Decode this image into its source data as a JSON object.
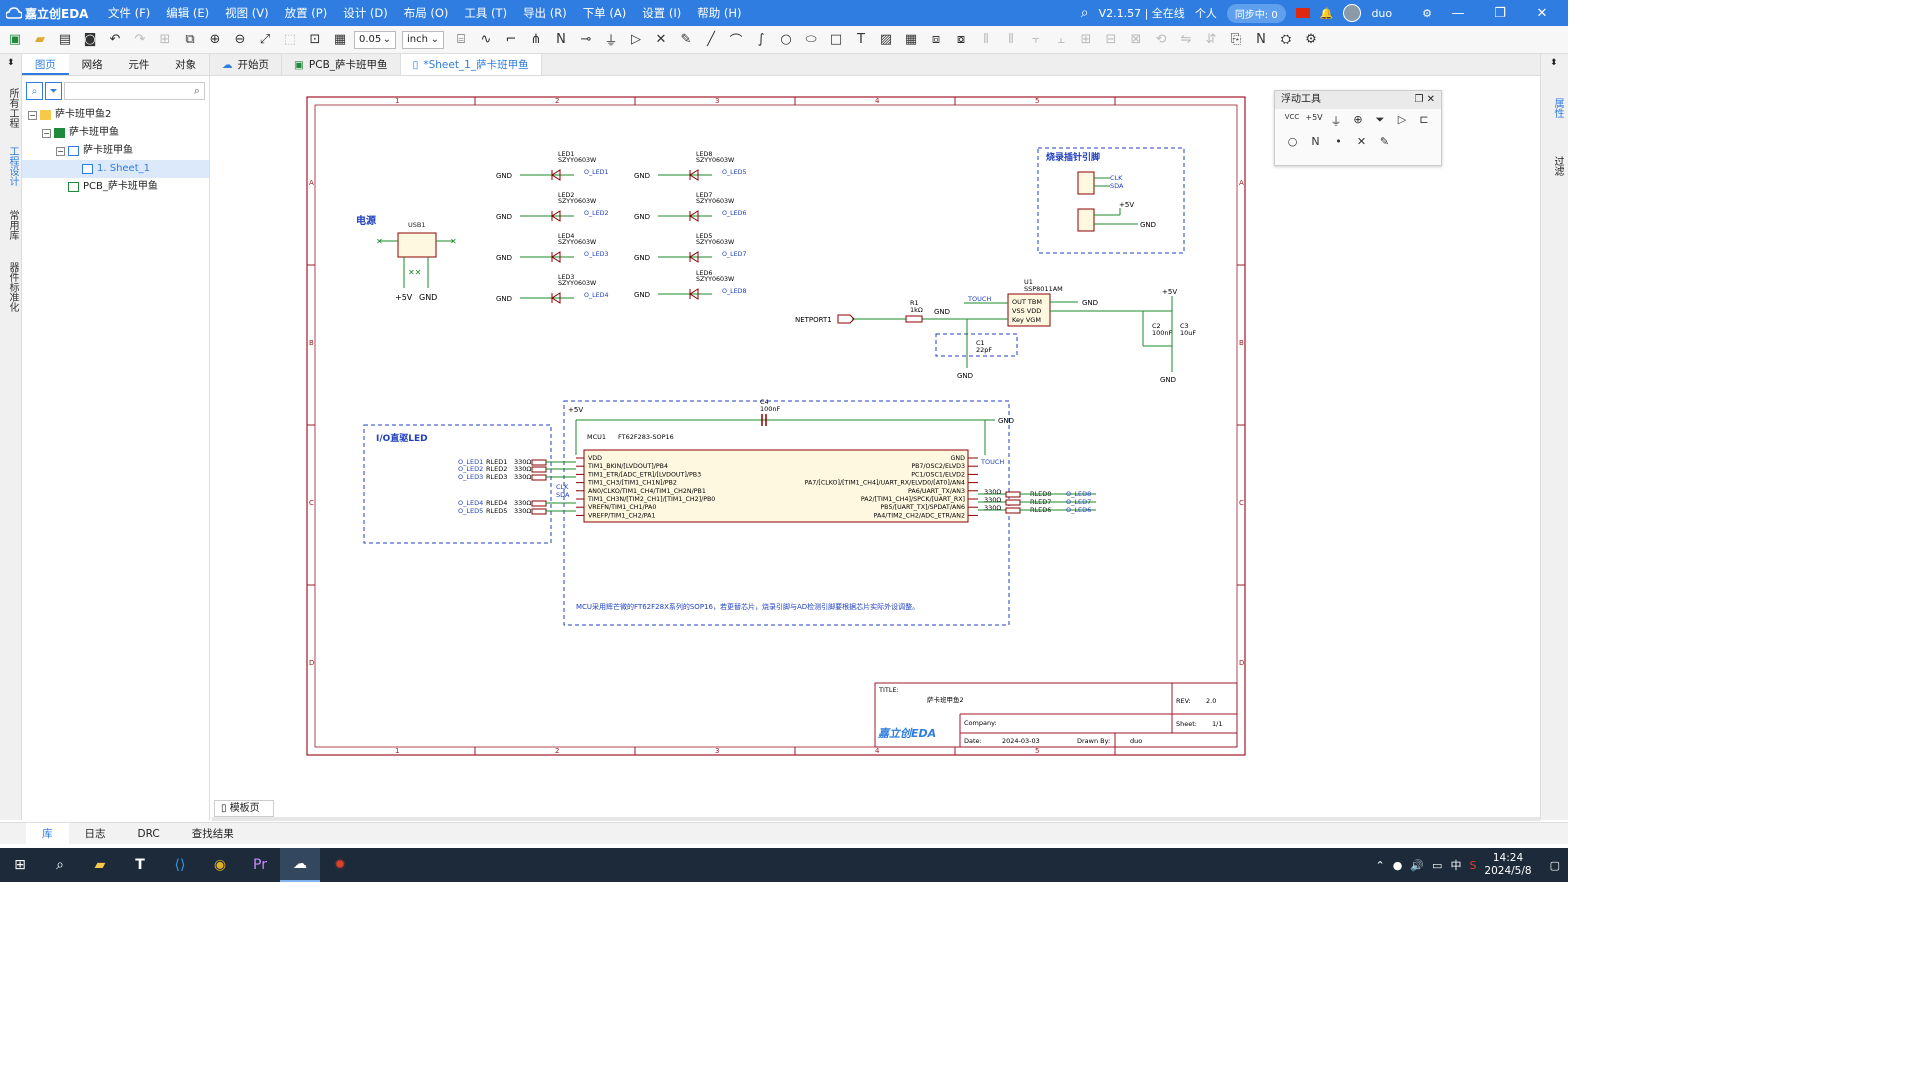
{
  "app": {
    "name": "嘉立创EDA",
    "version": "V2.1.57 | 全在线",
    "account": "个人",
    "sync": "同步中: 0",
    "user": "duo"
  },
  "menu": [
    "文件 (F)",
    "编辑 (E)",
    "视图 (V)",
    "放置 (P)",
    "设计 (D)",
    "布局 (O)",
    "工具 (T)",
    "导出 (R)",
    "下单 (A)",
    "设置 (I)",
    "帮助 (H)"
  ],
  "toolbar": {
    "grid": "0.05",
    "unit": "inch"
  },
  "left_strip": [
    "所有工程",
    "工程设计",
    "常用库",
    "器件标准化"
  ],
  "left_tabs": [
    "图页",
    "网络",
    "元件",
    "对象"
  ],
  "tree": {
    "root": "萨卡班甲鱼2",
    "board": "萨卡班甲鱼",
    "schematic": "萨卡班甲鱼",
    "sheet": "1. Sheet_1",
    "pcb": "PCB_萨卡班甲鱼"
  },
  "doc_tabs": [
    "开始页",
    "PCB_萨卡班甲鱼",
    "*Sheet_1_萨卡班甲鱼"
  ],
  "right_strip": [
    "属性",
    "过滤"
  ],
  "float_tools": {
    "title": "浮动工具",
    "row1": [
      "VCC",
      "+5V",
      "⏚",
      "⊕",
      "⏷",
      "▷",
      "⊏"
    ],
    "row2": [
      "○",
      "N",
      "•",
      "✕",
      "✎"
    ]
  },
  "sheet_tab": "模板页",
  "bottom_tabs": [
    "库",
    "日志",
    "DRC",
    "查找结果"
  ],
  "schematic": {
    "col_labels": [
      "1",
      "2",
      "3",
      "4",
      "5"
    ],
    "row_labels": [
      "A",
      "B",
      "C",
      "D"
    ],
    "power_label": "电源",
    "usb": "USB1",
    "p5v": "+5V",
    "gnd": "GND",
    "leds": [
      {
        "ref": "LED1",
        "part": "SZYY0603W",
        "net": "O_LED1"
      },
      {
        "ref": "LED2",
        "part": "SZYY0603W",
        "net": "O_LED2"
      },
      {
        "ref": "LED4",
        "part": "SZYY0603W",
        "net": "O_LED3"
      },
      {
        "ref": "LED3",
        "part": "SZYY0603W",
        "net": "O_LED4"
      },
      {
        "ref": "LED8",
        "part": "SZYY0603W",
        "net": "O_LED5"
      },
      {
        "ref": "LED7",
        "part": "SZYY0603W",
        "net": "O_LED6"
      },
      {
        "ref": "LED5",
        "part": "SZYY0603W",
        "net": "O_LED7"
      },
      {
        "ref": "LED6",
        "part": "SZYY0603W",
        "net": "O_LED8"
      }
    ],
    "burn_title": "烧录插针引脚",
    "clk": "CLK",
    "sda": "SDA",
    "u1": "U1",
    "u1_part": "SSP8011AM",
    "u1_pins": [
      "OUT TBM",
      "VSS  VDD",
      "Key  VGM"
    ],
    "touch": "TOUCH",
    "netport": "NETPORT1",
    "r1": "R1",
    "r1v": "1kΩ",
    "c1": "C1",
    "c1v": "22pF",
    "c2": "C2",
    "c2v": "100nF",
    "c3": "C3",
    "c3v": "10uF",
    "c4": "C4",
    "c4v": "100nF",
    "io_title": "I/O直驱LED",
    "mcu": "MCU1",
    "mcu_part": "FT62F283-SOP16",
    "mcu_left": [
      "VDD",
      "TIM1_BKIN/[LVDOUT]/PB4",
      "TIM1_ETR/[ADC_ETR]/[LVDOUT]/PB3",
      "TIM1_CH3/[TIM1_CH1N]/PB2",
      "AN0/CLKO/TIM1_CH4/TIM1_CH2N/PB1",
      "TIM1_CH3N/[TIM2_CH1]/[TIM1_CH2]/PB0",
      "VREFN/TIM1_CH1/PA0",
      "VREFP/TIM1_CH2/PA1"
    ],
    "mcu_right": [
      "GND",
      "PB7/OSC2/ELVD3",
      "PC1/OSC1/ELVD2",
      "PA7/[CLKO]/[TIM1_CH4]/UART_RX/ELVD0/[AT0]/AN4",
      "PA6/UART_TX/AN3",
      "PA2/[TIM1_CH4]/SPCK/[UART_RX]",
      "PB5/[UART_TX]/SPDAT/AN6",
      "PA4/TIM2_CH2/ADC_ETR/AN2"
    ],
    "left_nets": [
      [
        "O_LED1",
        "RLED1",
        "330Ω"
      ],
      [
        "O_LED2",
        "RLED2",
        "330Ω"
      ],
      [
        "O_LED3",
        "RLED3",
        "330Ω"
      ],
      [
        "O_LED4",
        "RLED4",
        "330Ω"
      ],
      [
        "O_LED5",
        "RLED5",
        "330Ω"
      ]
    ],
    "right_nets": [
      [
        "O_LED8",
        "RLED8",
        "330Ω"
      ],
      [
        "O_LED7",
        "RLED7",
        "330Ω"
      ],
      [
        "O_LED6",
        "RLED6",
        "330Ω"
      ]
    ],
    "note": "MCU采用辉芒微的FT62F28X系列的SOP16，若更替芯片，烧录引脚与AD检测引脚要根据芯片实际外设调整。",
    "title_label": "TITLE:",
    "title": "萨卡班甲鱼2",
    "rev_label": "REV:",
    "rev": "2.0",
    "company_label": "Company:",
    "sheet_label": "Sheet:",
    "sheet_no": "1/1",
    "date_label": "Date:",
    "date": "2024-03-03",
    "drawn_label": "Drawn By:",
    "drawn": "duo",
    "brand": "嘉立创EDA"
  },
  "taskbar": {
    "ime": "中",
    "time": "14:24",
    "date": "2024/5/8"
  },
  "colors": {
    "accent": "#2f7de1",
    "frame": "#a0192a",
    "wire": "#1a8a2a",
    "symbol": "#8b0000",
    "net": "#1f3fbf"
  }
}
